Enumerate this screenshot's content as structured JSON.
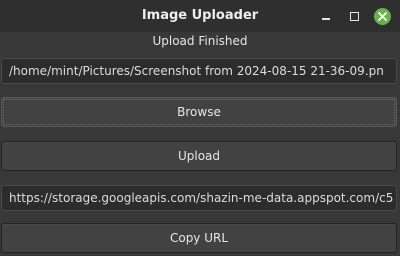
{
  "window": {
    "title": "Image Uploader",
    "close_color": "#6ab04c"
  },
  "status_text": "Upload Finished",
  "file_path": {
    "value": "/home/mint/Pictures/Screenshot from 2024-08-15 21-36-09.pn"
  },
  "buttons": {
    "browse": "Browse",
    "upload": "Upload",
    "copy_url": "Copy URL"
  },
  "url_field": {
    "value": "https://storage.googleapis.com/shazin-me-data.appspot.com/c5"
  }
}
